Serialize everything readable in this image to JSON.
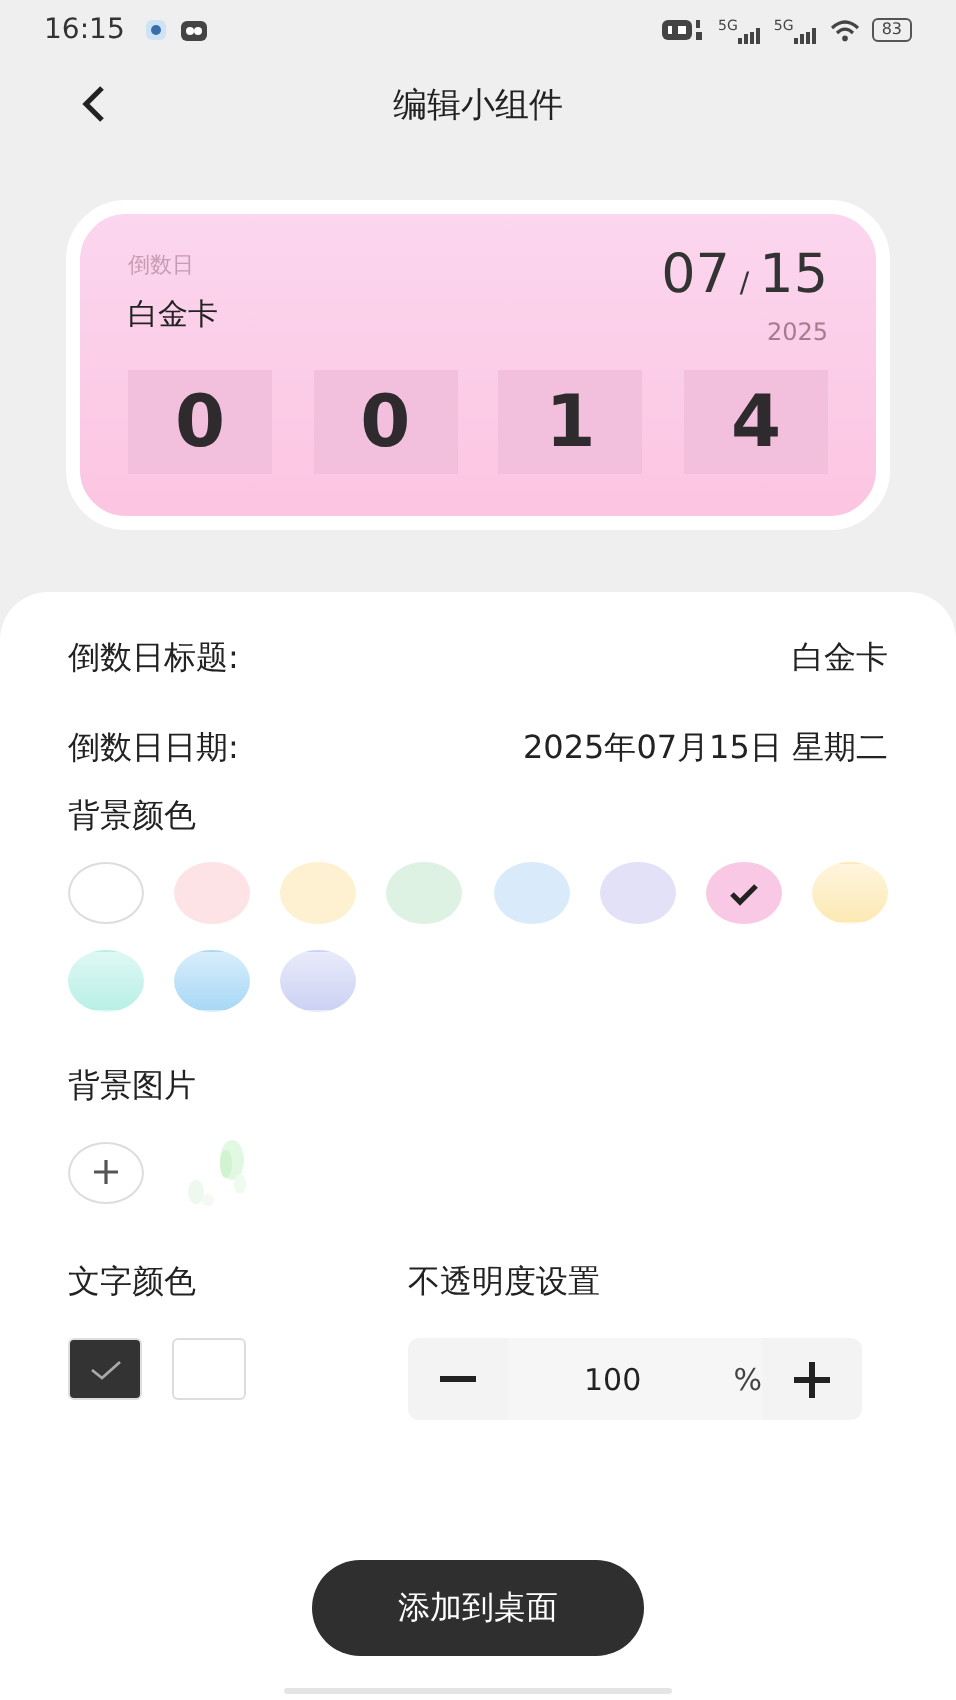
{
  "status_bar": {
    "time": "16:15",
    "network_labels": [
      "5G",
      "5G"
    ],
    "battery": "83"
  },
  "header": {
    "title": "编辑小组件"
  },
  "widget": {
    "label": "倒数日",
    "title": "白金卡",
    "month": "07",
    "separator": "/",
    "day": "15",
    "year": "2025",
    "digits": [
      "0",
      "0",
      "1",
      "4"
    ]
  },
  "fields": [
    {
      "label": "倒数日标题:",
      "value": "白金卡"
    },
    {
      "label": "倒数日日期:",
      "value": "2025年07月15日 星期二"
    }
  ],
  "background_color": {
    "label": "背景颜色",
    "swatches": [
      {
        "color": "#ffffff",
        "selected": false
      },
      {
        "color": "#fde3e6",
        "selected": false
      },
      {
        "color": "#fdf1d2",
        "selected": false
      },
      {
        "color": "#ddf2e3",
        "selected": false
      },
      {
        "color": "#d9ebfb",
        "selected": false
      },
      {
        "color": "#e3e1f8",
        "selected": false
      },
      {
        "color": "#f8c8e4",
        "selected": true
      },
      {
        "color": "#fde9b4",
        "selected": false
      },
      {
        "color": "#b8f0e6",
        "selected": false
      },
      {
        "color": "#a8d8f6",
        "selected": false
      },
      {
        "color": "#ccd2f4",
        "selected": false
      }
    ]
  },
  "background_image": {
    "label": "背景图片"
  },
  "text_color": {
    "label": "文字颜色",
    "swatches": [
      {
        "color": "#333333",
        "selected": true
      },
      {
        "color": "#ffffff",
        "selected": false
      }
    ]
  },
  "opacity": {
    "label": "不透明度设置",
    "value": "100",
    "unit": "%"
  },
  "add_button": "添加到桌面"
}
